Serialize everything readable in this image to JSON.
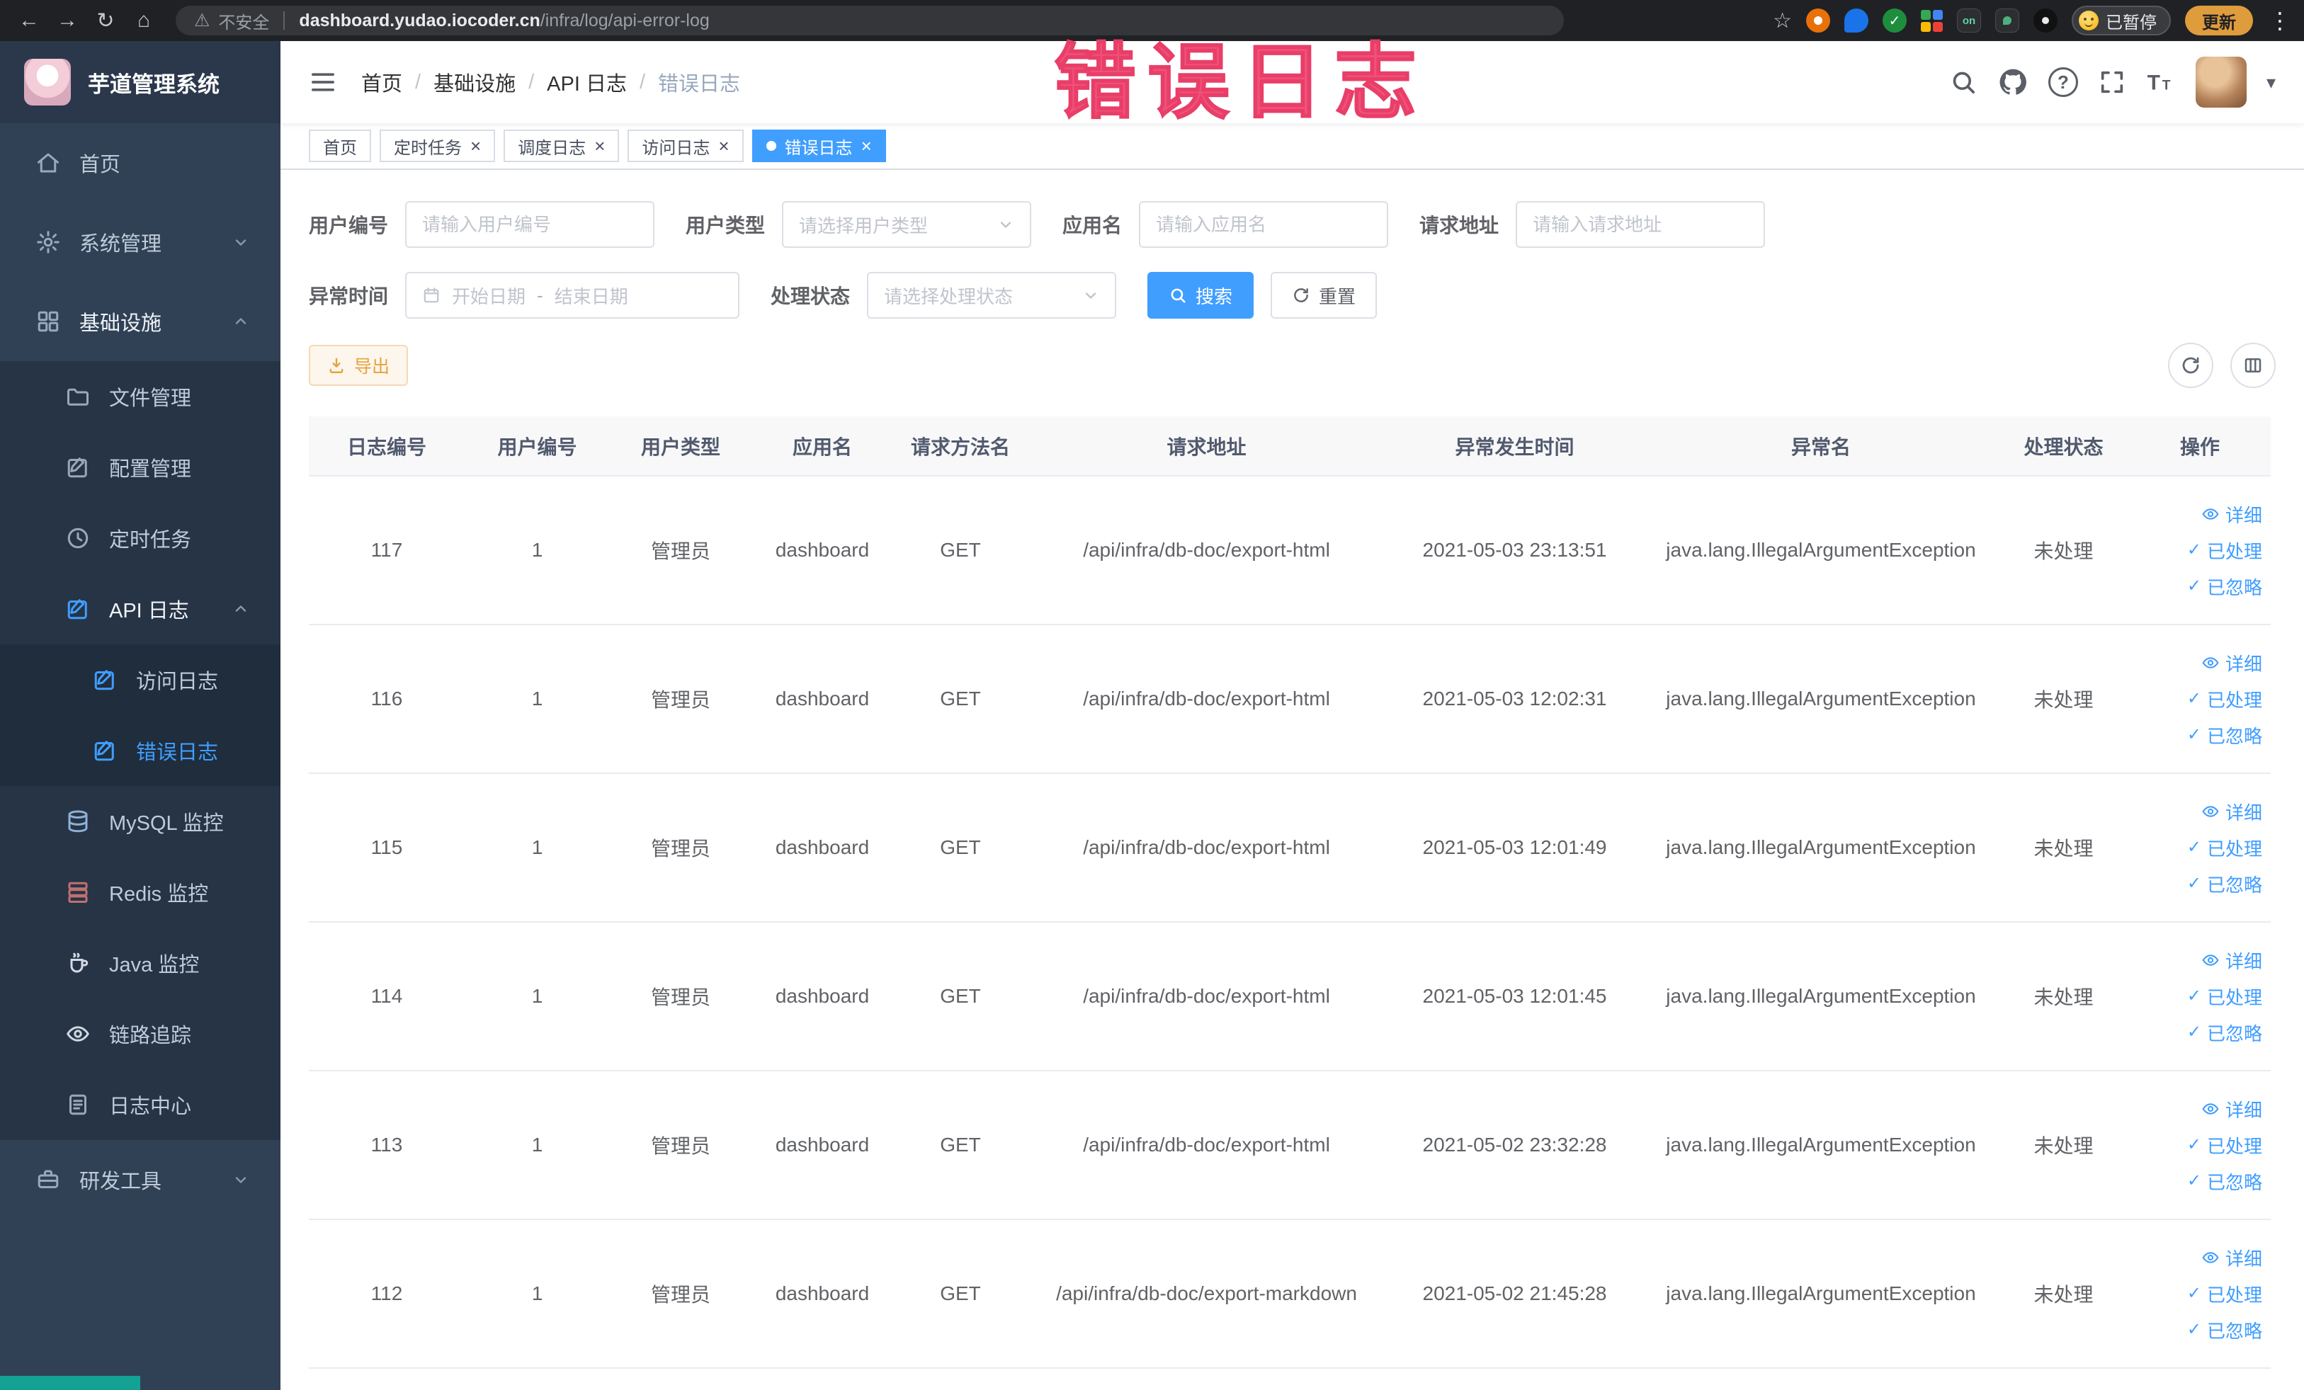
{
  "browser": {
    "security": "不安全",
    "url_domain": "dashboard.yudao.iocoder.cn",
    "url_path": "/infra/log/api-error-log",
    "paused_label": "已暂停",
    "update_label": "更新",
    "ext_on_label": "on"
  },
  "icons": {
    "back": "←",
    "forward": "→",
    "reload": "↻",
    "home": "⌂",
    "warning": "⚠",
    "star": "☆",
    "kebab": "⋮",
    "caret": "▾",
    "check": "✓",
    "question": "?",
    "close": "×",
    "dash": "-"
  },
  "watermark": {
    "text": "错误日志"
  },
  "sidebar": {
    "logo_title": "芋道管理系统",
    "home": "首页",
    "system": "系统管理",
    "infra": "基础设施",
    "file": "文件管理",
    "config": "配置管理",
    "cron": "定时任务",
    "api_log": "API 日志",
    "access_log": "访问日志",
    "error_log": "错误日志",
    "mysql": "MySQL 监控",
    "redis": "Redis 监控",
    "java": "Java 监控",
    "tracing": "链路追踪",
    "log_center": "日志中心",
    "devtools": "研发工具"
  },
  "breadcrumb": {
    "items": [
      "首页",
      "基础设施",
      "API 日志",
      "错误日志"
    ]
  },
  "tabs": [
    {
      "label": "首页"
    },
    {
      "label": "定时任务"
    },
    {
      "label": "调度日志"
    },
    {
      "label": "访问日志"
    },
    {
      "label": "错误日志"
    }
  ],
  "filters": {
    "user_id": {
      "label": "用户编号",
      "placeholder": "请输入用户编号"
    },
    "user_type": {
      "label": "用户类型",
      "placeholder": "请选择用户类型"
    },
    "app_name": {
      "label": "应用名",
      "placeholder": "请输入应用名"
    },
    "request_url": {
      "label": "请求地址",
      "placeholder": "请输入请求地址"
    },
    "exception_time": {
      "label": "异常时间",
      "start_placeholder": "开始日期",
      "separator": "-",
      "end_placeholder": "结束日期"
    },
    "process_status": {
      "label": "处理状态",
      "placeholder": "请选择处理状态"
    },
    "search_label": "搜索",
    "reset_label": "重置"
  },
  "toolbar": {
    "export_label": "导出"
  },
  "table": {
    "columns": [
      "日志编号",
      "用户编号",
      "用户类型",
      "应用名",
      "请求方法名",
      "请求地址",
      "异常发生时间",
      "异常名",
      "处理状态",
      "操作"
    ],
    "rows": [
      {
        "id": "117",
        "user_id": "1",
        "user_type": "管理员",
        "app": "dashboard",
        "method": "GET",
        "url": "/api/infra/db-doc/export-html",
        "time": "2021-05-03 23:13:51",
        "exception": "java.lang.IllegalArgumentException",
        "status": "未处理"
      },
      {
        "id": "116",
        "user_id": "1",
        "user_type": "管理员",
        "app": "dashboard",
        "method": "GET",
        "url": "/api/infra/db-doc/export-html",
        "time": "2021-05-03 12:02:31",
        "exception": "java.lang.IllegalArgumentException",
        "status": "未处理"
      },
      {
        "id": "115",
        "user_id": "1",
        "user_type": "管理员",
        "app": "dashboard",
        "method": "GET",
        "url": "/api/infra/db-doc/export-html",
        "time": "2021-05-03 12:01:49",
        "exception": "java.lang.IllegalArgumentException",
        "status": "未处理"
      },
      {
        "id": "114",
        "user_id": "1",
        "user_type": "管理员",
        "app": "dashboard",
        "method": "GET",
        "url": "/api/infra/db-doc/export-html",
        "time": "2021-05-03 12:01:45",
        "exception": "java.lang.IllegalArgumentException",
        "status": "未处理"
      },
      {
        "id": "113",
        "user_id": "1",
        "user_type": "管理员",
        "app": "dashboard",
        "method": "GET",
        "url": "/api/infra/db-doc/export-html",
        "time": "2021-05-02 23:32:28",
        "exception": "java.lang.IllegalArgumentException",
        "status": "未处理"
      },
      {
        "id": "112",
        "user_id": "1",
        "user_type": "管理员",
        "app": "dashboard",
        "method": "GET",
        "url": "/api/infra/db-doc/export-markdown",
        "time": "2021-05-02 21:45:28",
        "exception": "java.lang.IllegalArgumentException",
        "status": "未处理"
      }
    ]
  },
  "row_actions": {
    "detail": "详细",
    "process": "已处理",
    "ignore": "已忽略"
  },
  "colors": {
    "accent": "#409eff",
    "warning": "#e6a23c",
    "sidebar_bg": "#304156",
    "active_text": "#409eff"
  }
}
